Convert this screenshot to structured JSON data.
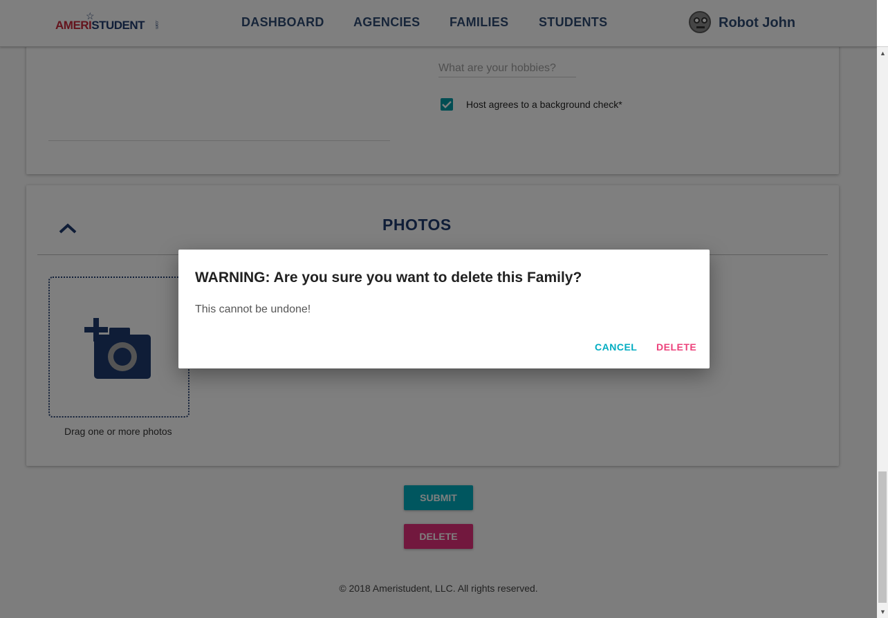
{
  "header": {
    "logo": {
      "part1": "AMERI",
      "part2": "STUDENT",
      "suffix": ".com"
    },
    "nav": [
      "DASHBOARD",
      "AGENCIES",
      "FAMILIES",
      "STUDENTS"
    ],
    "user": {
      "name": "Robot John",
      "avatar_icon": "robot-avatar-icon"
    }
  },
  "form": {
    "hobbies": {
      "placeholder": "What are your hobbies?",
      "value": ""
    },
    "background_check": {
      "label": "Host agrees to a background check*",
      "checked": true
    }
  },
  "photos": {
    "title": "PHOTOS",
    "collapse_icon": "chevron-up-icon",
    "dropzone_icon": "add-photo-icon",
    "dropzone_label": "Drag one or more photos"
  },
  "actions": {
    "submit": "SUBMIT",
    "delete": "DELETE"
  },
  "footer": {
    "text": "© 2018 Ameristudent, LLC. All rights reserved."
  },
  "dialog": {
    "title": "WARNING: Are you sure you want to delete this Family?",
    "body": "This cannot be undone!",
    "cancel": "CANCEL",
    "confirm": "DELETE"
  },
  "colors": {
    "navy": "#1e3a6e",
    "teal": "#00adbe",
    "pink": "#e5317c",
    "dialog_cancel": "#00acc1",
    "dialog_delete": "#ec407a"
  }
}
